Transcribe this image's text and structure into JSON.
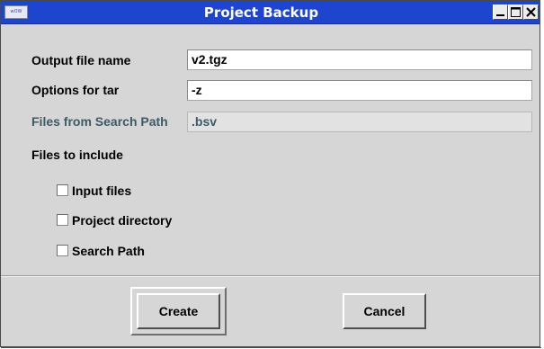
{
  "window": {
    "title": "Project Backup",
    "app_icon_text": "wOW",
    "controls": {
      "minimize": "minimize-icon",
      "maximize": "maximize-icon",
      "close": "close-icon"
    }
  },
  "form": {
    "output_file": {
      "label": "Output file name",
      "value": "v2.tgz"
    },
    "tar_options": {
      "label": "Options for tar",
      "value": "-z"
    },
    "search_path_files": {
      "label": "Files from Search Path",
      "value": ".bsv",
      "disabled": true
    },
    "include_heading": "Files to include",
    "include_options": [
      {
        "label": "Input files",
        "checked": false
      },
      {
        "label": "Project directory",
        "checked": false
      },
      {
        "label": "Search Path",
        "checked": false
      }
    ]
  },
  "buttons": {
    "create": "Create",
    "cancel": "Cancel"
  },
  "colors": {
    "titlebar": "#1e45ce",
    "background": "#d6d6d6",
    "disabled_text": "#3d5a66"
  }
}
